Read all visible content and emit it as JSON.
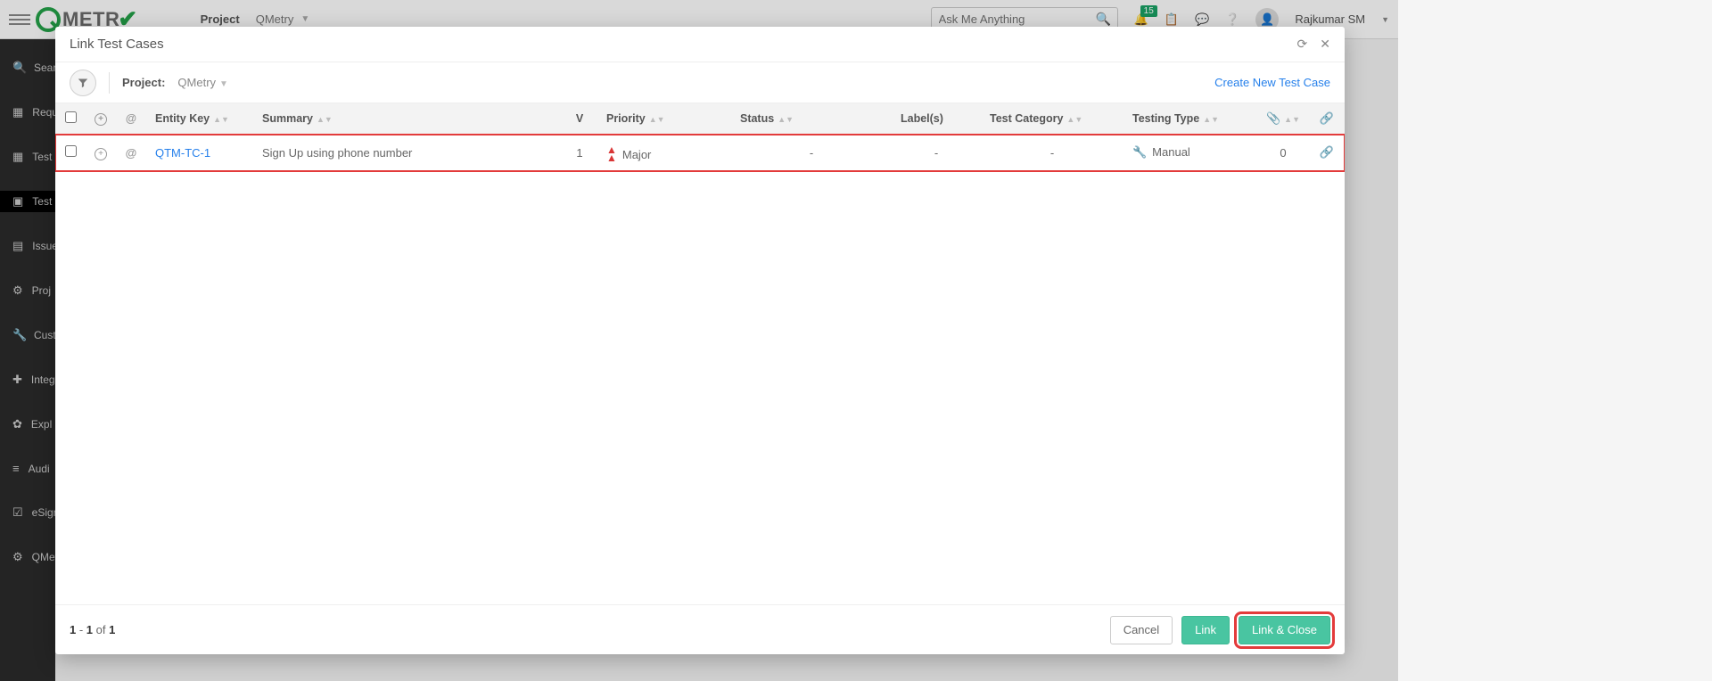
{
  "topbar": {
    "project_label": "Project",
    "project_name": "QMetry",
    "search_placeholder": "Ask Me Anything",
    "notification_count": "15",
    "username": "Rajkumar SM",
    "logo_text": "METR"
  },
  "sidebar": {
    "items": [
      {
        "icon": "🔍",
        "label": "Search"
      },
      {
        "icon": "▦",
        "label": "Requ"
      },
      {
        "icon": "▦",
        "label": "Test"
      },
      {
        "icon": "▣",
        "label": "Test",
        "active": true
      },
      {
        "icon": "▤",
        "label": "Issue"
      },
      {
        "icon": "⚙",
        "label": "Proj"
      },
      {
        "icon": "🔧",
        "label": "Cust"
      },
      {
        "icon": "✚",
        "label": "Integ"
      },
      {
        "icon": "✿",
        "label": "Expl"
      },
      {
        "icon": "≡",
        "label": "Audi"
      },
      {
        "icon": "☑",
        "label": "eSign"
      },
      {
        "icon": "⚙",
        "label": "QMetry Insight"
      }
    ]
  },
  "modal": {
    "title": "Link Test Cases",
    "project_label": "Project:",
    "project_value": "QMetry",
    "create_link": "Create New Test Case",
    "columns": {
      "entity_key": "Entity Key",
      "summary": "Summary",
      "v": "V",
      "priority": "Priority",
      "status": "Status",
      "labels": "Label(s)",
      "test_category": "Test Category",
      "testing_type": "Testing Type"
    },
    "rows": [
      {
        "key": "QTM-TC-1",
        "summary": "Sign Up using phone number",
        "v": "1",
        "priority": "Major",
        "status": "-",
        "labels": "-",
        "category": "-",
        "type": "Manual",
        "attachments": "0"
      }
    ],
    "pager_from": "1",
    "pager_to": "1",
    "pager_of_word": "of",
    "pager_total": "1",
    "buttons": {
      "cancel": "Cancel",
      "link": "Link",
      "link_close": "Link & Close"
    }
  }
}
